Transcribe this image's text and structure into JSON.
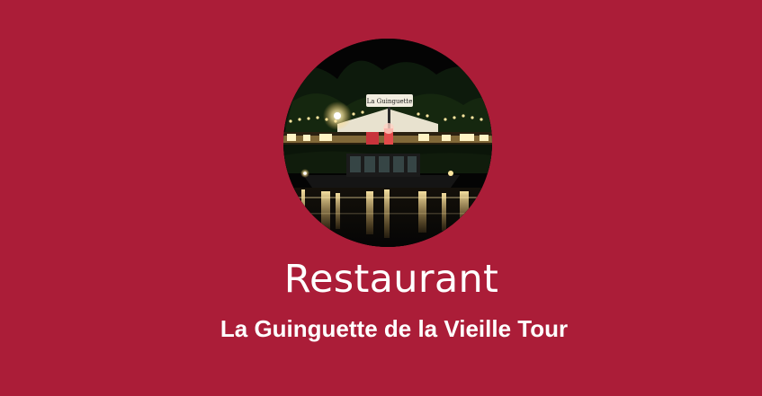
{
  "background_color": "#ab1d38",
  "photo": {
    "alt": "Night view of the riverside guinguette with a boat and lights reflected on the water",
    "sign_text": "La Guinguette"
  },
  "header": {
    "category": "Restaurant",
    "name": "La Guinguette de la Vieille Tour"
  }
}
